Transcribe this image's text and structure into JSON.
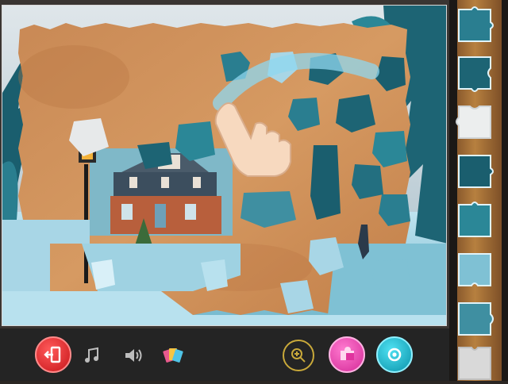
{
  "game": {
    "puzzle_scene": "winter-house-jigsaw",
    "colors": {
      "paper": "#d1925a",
      "paper_dark": "#b87543",
      "sky": "#c7d4dc",
      "snow": "#d9f0f8",
      "tree_teal": "#1f6e80",
      "tray_wood": "#b7803f",
      "toolbar_bg": "#242424"
    }
  },
  "toolbar": {
    "exit_icon": "exit-door-icon",
    "music_icon": "music-note-icon",
    "sound_icon": "speaker-icon",
    "cards_icon": "cards-icon",
    "zoom_icon": "zoom-in-icon",
    "sort_icon": "puzzle-piece-icon",
    "rotate_icon": "rotate-icon"
  },
  "tray": {
    "piece_count": 8
  }
}
